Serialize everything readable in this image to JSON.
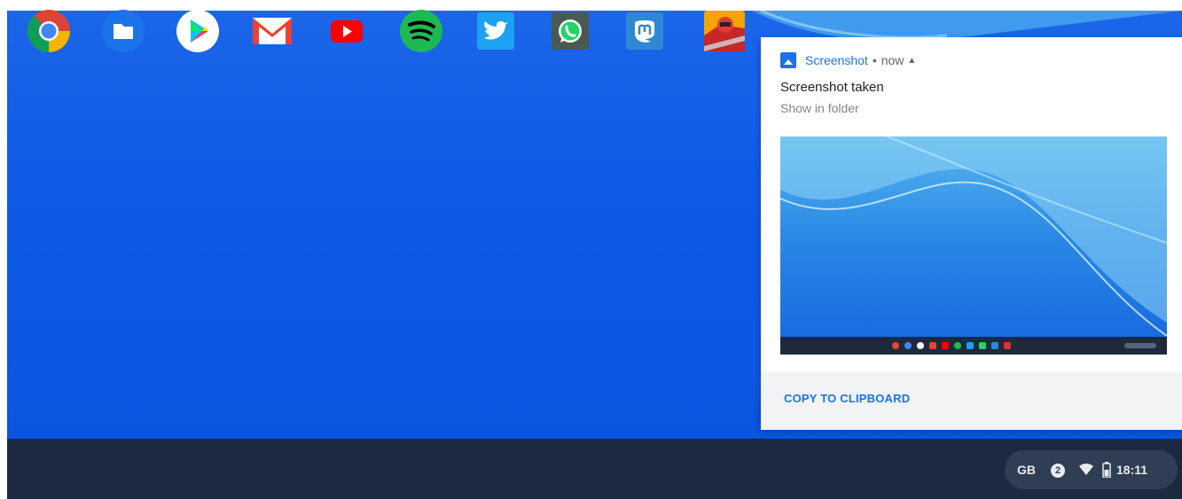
{
  "notification": {
    "app_name": "Screenshot",
    "separator": "•",
    "time": "now",
    "title": "Screenshot taken",
    "subtitle": "Show in folder",
    "action_label": "COPY TO CLIPBOARD"
  },
  "shelf": {
    "apps": [
      "chrome-icon",
      "files-icon",
      "play-store-icon",
      "gmail-icon",
      "youtube-icon",
      "spotify-icon",
      "twitter-icon",
      "whatsapp-icon",
      "mastodon-icon",
      "power-rangers-icon"
    ]
  },
  "status_tray": {
    "keyboard_layout": "GB",
    "notification_count": "2",
    "time": "18:11"
  },
  "colors": {
    "accent": "#1a73e8",
    "shelf": "#1c2a3f",
    "desktop": "#0f5be6"
  }
}
